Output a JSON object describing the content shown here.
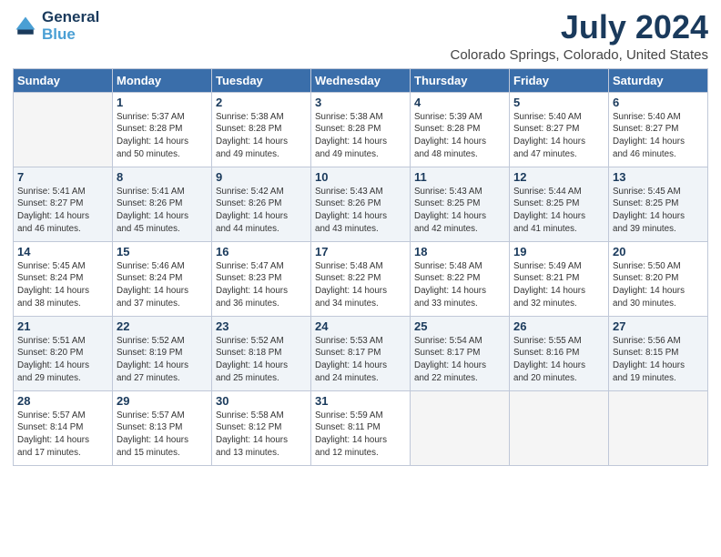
{
  "logo": {
    "line1": "General",
    "line2": "Blue"
  },
  "title": "July 2024",
  "subtitle": "Colorado Springs, Colorado, United States",
  "header": {
    "days": [
      "Sunday",
      "Monday",
      "Tuesday",
      "Wednesday",
      "Thursday",
      "Friday",
      "Saturday"
    ]
  },
  "weeks": [
    {
      "shaded": false,
      "days": [
        {
          "num": "",
          "info": "",
          "empty": true
        },
        {
          "num": "1",
          "info": "Sunrise: 5:37 AM\nSunset: 8:28 PM\nDaylight: 14 hours\nand 50 minutes."
        },
        {
          "num": "2",
          "info": "Sunrise: 5:38 AM\nSunset: 8:28 PM\nDaylight: 14 hours\nand 49 minutes."
        },
        {
          "num": "3",
          "info": "Sunrise: 5:38 AM\nSunset: 8:28 PM\nDaylight: 14 hours\nand 49 minutes."
        },
        {
          "num": "4",
          "info": "Sunrise: 5:39 AM\nSunset: 8:28 PM\nDaylight: 14 hours\nand 48 minutes."
        },
        {
          "num": "5",
          "info": "Sunrise: 5:40 AM\nSunset: 8:27 PM\nDaylight: 14 hours\nand 47 minutes."
        },
        {
          "num": "6",
          "info": "Sunrise: 5:40 AM\nSunset: 8:27 PM\nDaylight: 14 hours\nand 46 minutes."
        }
      ]
    },
    {
      "shaded": true,
      "days": [
        {
          "num": "7",
          "info": "Sunrise: 5:41 AM\nSunset: 8:27 PM\nDaylight: 14 hours\nand 46 minutes."
        },
        {
          "num": "8",
          "info": "Sunrise: 5:41 AM\nSunset: 8:26 PM\nDaylight: 14 hours\nand 45 minutes."
        },
        {
          "num": "9",
          "info": "Sunrise: 5:42 AM\nSunset: 8:26 PM\nDaylight: 14 hours\nand 44 minutes."
        },
        {
          "num": "10",
          "info": "Sunrise: 5:43 AM\nSunset: 8:26 PM\nDaylight: 14 hours\nand 43 minutes."
        },
        {
          "num": "11",
          "info": "Sunrise: 5:43 AM\nSunset: 8:25 PM\nDaylight: 14 hours\nand 42 minutes."
        },
        {
          "num": "12",
          "info": "Sunrise: 5:44 AM\nSunset: 8:25 PM\nDaylight: 14 hours\nand 41 minutes."
        },
        {
          "num": "13",
          "info": "Sunrise: 5:45 AM\nSunset: 8:25 PM\nDaylight: 14 hours\nand 39 minutes."
        }
      ]
    },
    {
      "shaded": false,
      "days": [
        {
          "num": "14",
          "info": "Sunrise: 5:45 AM\nSunset: 8:24 PM\nDaylight: 14 hours\nand 38 minutes."
        },
        {
          "num": "15",
          "info": "Sunrise: 5:46 AM\nSunset: 8:24 PM\nDaylight: 14 hours\nand 37 minutes."
        },
        {
          "num": "16",
          "info": "Sunrise: 5:47 AM\nSunset: 8:23 PM\nDaylight: 14 hours\nand 36 minutes."
        },
        {
          "num": "17",
          "info": "Sunrise: 5:48 AM\nSunset: 8:22 PM\nDaylight: 14 hours\nand 34 minutes."
        },
        {
          "num": "18",
          "info": "Sunrise: 5:48 AM\nSunset: 8:22 PM\nDaylight: 14 hours\nand 33 minutes."
        },
        {
          "num": "19",
          "info": "Sunrise: 5:49 AM\nSunset: 8:21 PM\nDaylight: 14 hours\nand 32 minutes."
        },
        {
          "num": "20",
          "info": "Sunrise: 5:50 AM\nSunset: 8:20 PM\nDaylight: 14 hours\nand 30 minutes."
        }
      ]
    },
    {
      "shaded": true,
      "days": [
        {
          "num": "21",
          "info": "Sunrise: 5:51 AM\nSunset: 8:20 PM\nDaylight: 14 hours\nand 29 minutes."
        },
        {
          "num": "22",
          "info": "Sunrise: 5:52 AM\nSunset: 8:19 PM\nDaylight: 14 hours\nand 27 minutes."
        },
        {
          "num": "23",
          "info": "Sunrise: 5:52 AM\nSunset: 8:18 PM\nDaylight: 14 hours\nand 25 minutes."
        },
        {
          "num": "24",
          "info": "Sunrise: 5:53 AM\nSunset: 8:17 PM\nDaylight: 14 hours\nand 24 minutes."
        },
        {
          "num": "25",
          "info": "Sunrise: 5:54 AM\nSunset: 8:17 PM\nDaylight: 14 hours\nand 22 minutes."
        },
        {
          "num": "26",
          "info": "Sunrise: 5:55 AM\nSunset: 8:16 PM\nDaylight: 14 hours\nand 20 minutes."
        },
        {
          "num": "27",
          "info": "Sunrise: 5:56 AM\nSunset: 8:15 PM\nDaylight: 14 hours\nand 19 minutes."
        }
      ]
    },
    {
      "shaded": false,
      "days": [
        {
          "num": "28",
          "info": "Sunrise: 5:57 AM\nSunset: 8:14 PM\nDaylight: 14 hours\nand 17 minutes."
        },
        {
          "num": "29",
          "info": "Sunrise: 5:57 AM\nSunset: 8:13 PM\nDaylight: 14 hours\nand 15 minutes."
        },
        {
          "num": "30",
          "info": "Sunrise: 5:58 AM\nSunset: 8:12 PM\nDaylight: 14 hours\nand 13 minutes."
        },
        {
          "num": "31",
          "info": "Sunrise: 5:59 AM\nSunset: 8:11 PM\nDaylight: 14 hours\nand 12 minutes."
        },
        {
          "num": "",
          "info": "",
          "empty": true
        },
        {
          "num": "",
          "info": "",
          "empty": true
        },
        {
          "num": "",
          "info": "",
          "empty": true
        }
      ]
    }
  ]
}
